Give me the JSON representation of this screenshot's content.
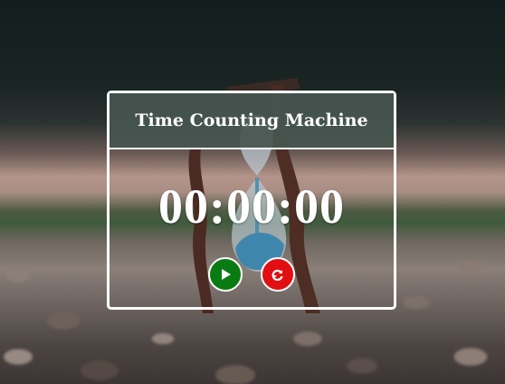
{
  "app": {
    "title": "Time Counting Machine"
  },
  "timer": {
    "display": "00:00:00"
  },
  "controls": {
    "play_icon": "play-icon",
    "reset_icon": "refresh-icon"
  },
  "colors": {
    "header_bg": "#465650",
    "border": "#ffffff",
    "play_button": "#0a7a12",
    "reset_button": "#e20f12",
    "text": "#ffffff"
  }
}
